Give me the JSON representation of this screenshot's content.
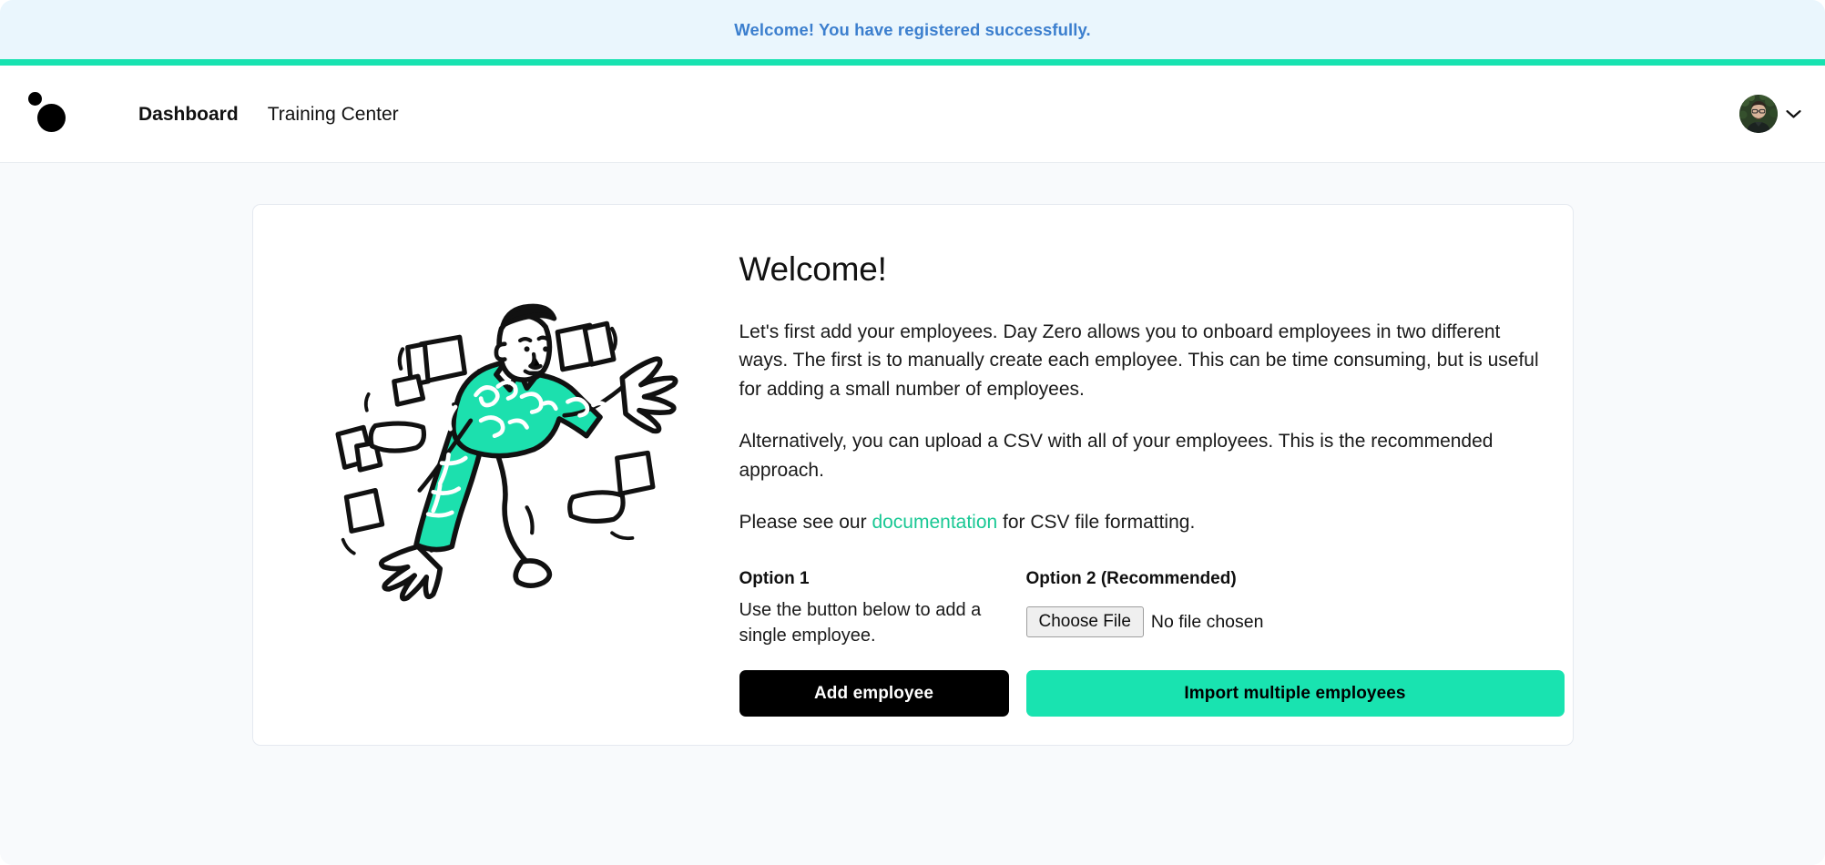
{
  "flash": {
    "message": "Welcome! You have registered successfully.",
    "background_color": "#eaf6fd",
    "text_color": "#3c7fce",
    "accent_rule_color": "#17e2b0"
  },
  "navbar": {
    "logo_name": "day-zero-logo",
    "links": [
      {
        "label": "Dashboard",
        "active": true
      },
      {
        "label": "Training Center",
        "active": false
      }
    ],
    "user_menu": {
      "avatar_name": "user-avatar",
      "chevron_name": "chevron-down-icon"
    }
  },
  "card": {
    "illustration_name": "person-with-flying-papers-illustration",
    "heading": "Welcome!",
    "paragraphs": [
      "Let's first add your employees. Day Zero allows you to onboard employees in two different ways. The first is to manually create each employee. This can be time consuming, but is useful for adding a small number of employees.",
      "Alternatively, you can upload a CSV with all of your employees. This is the recommended approach."
    ],
    "doc_line": {
      "before": "Please see our ",
      "link_text": "documentation",
      "after": " for CSV file formatting.",
      "link_color": "#19c894"
    },
    "option_one": {
      "title": "Option 1",
      "description": "Use the button below to add a single employee.",
      "button_label": "Add employee",
      "button_color": "#000000",
      "button_text_color": "#ffffff"
    },
    "option_two": {
      "title": "Option 2 (Recommended)",
      "file_input": {
        "button_label": "Choose File",
        "status_text": "No file chosen"
      },
      "button_label": "Import multiple employees",
      "button_color": "#19e3b0",
      "button_text_color": "#000000"
    }
  }
}
